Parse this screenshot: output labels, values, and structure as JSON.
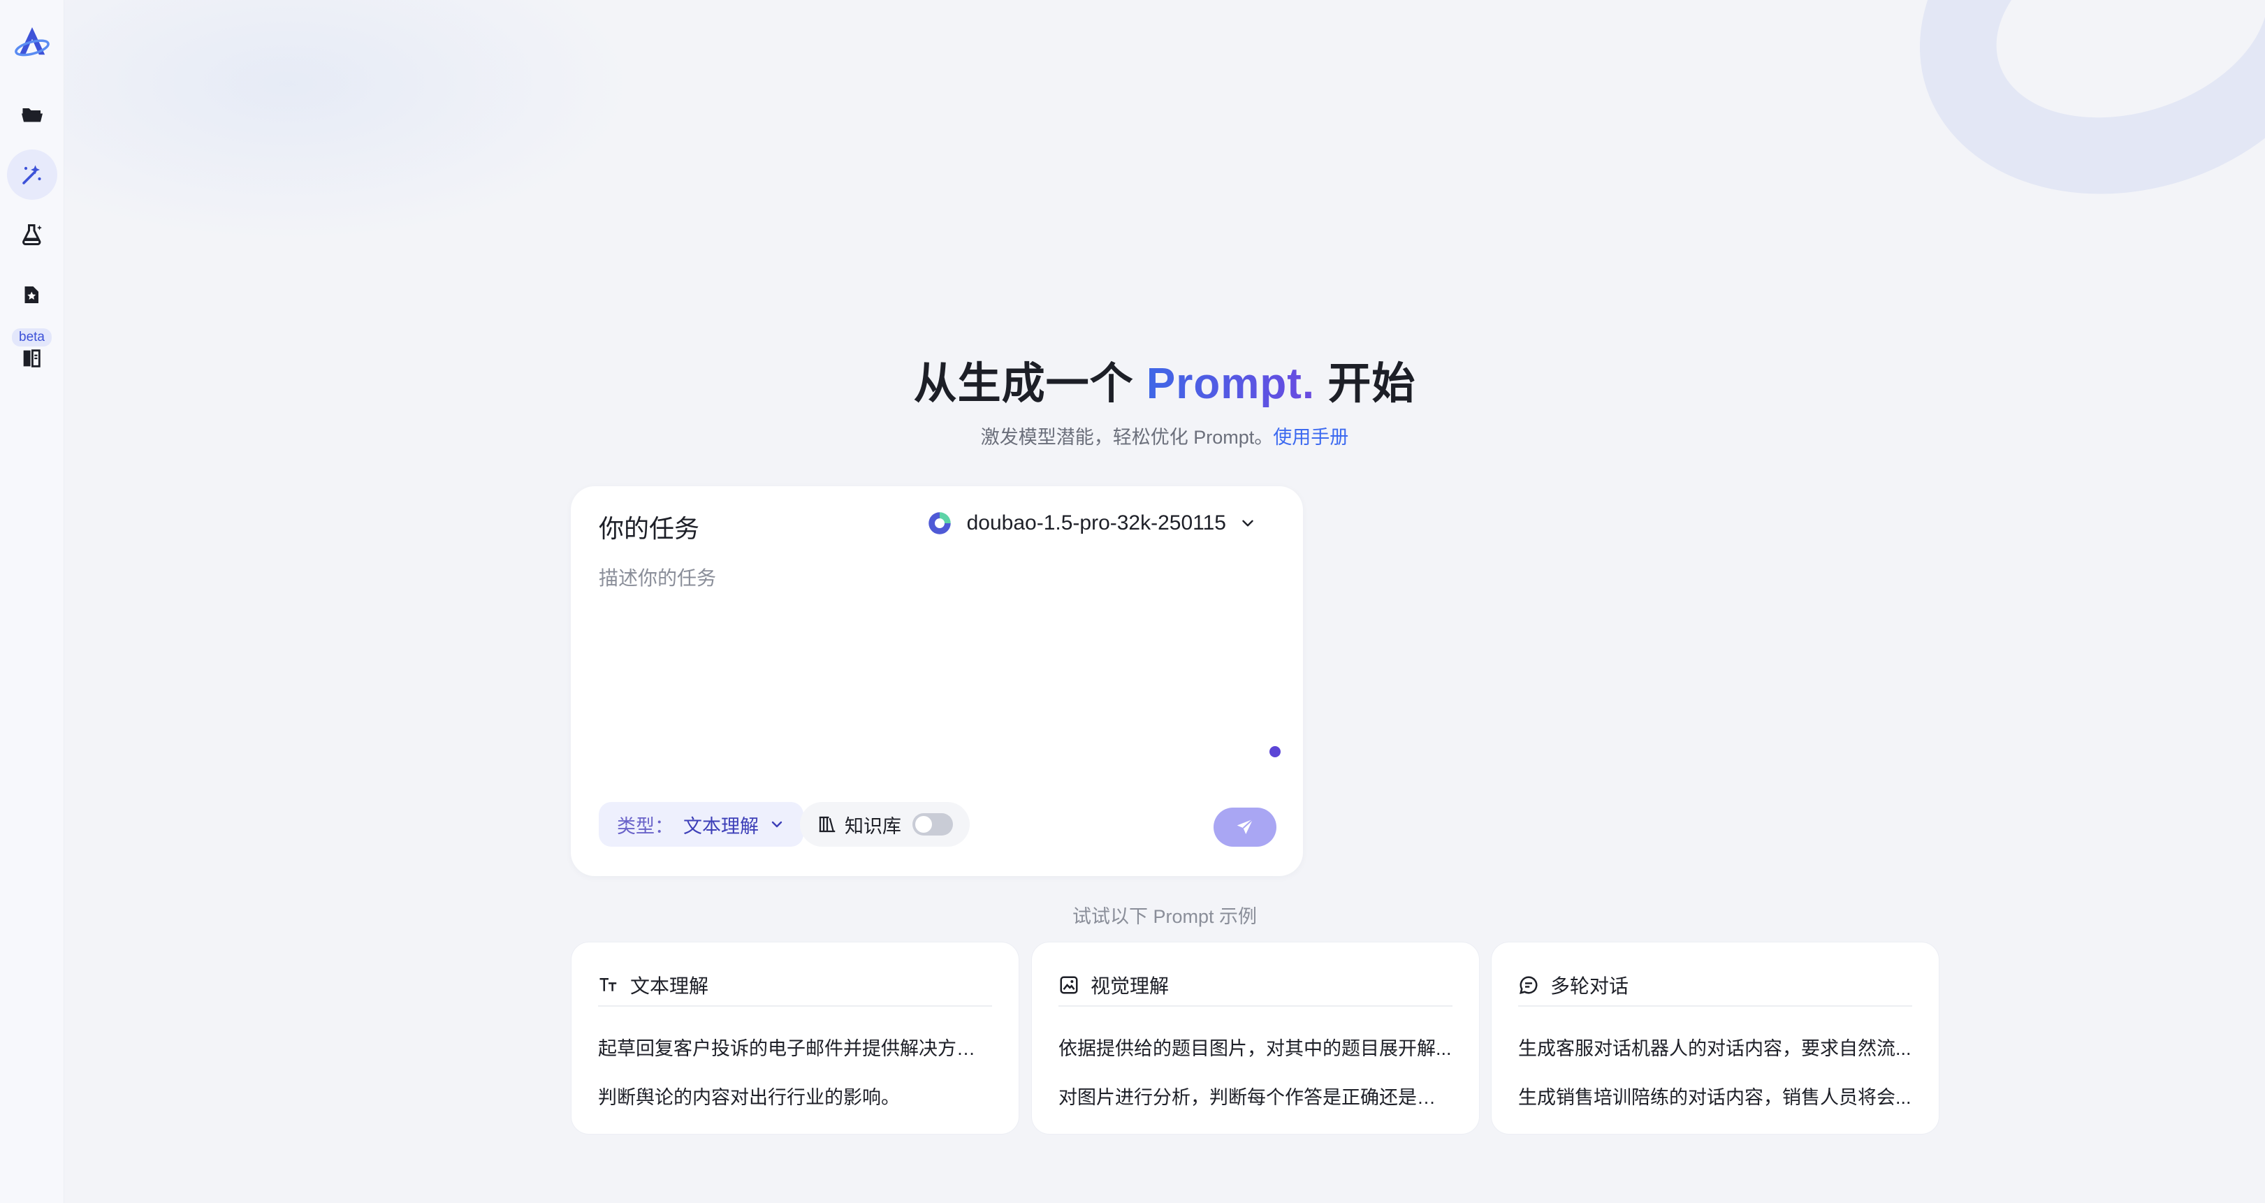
{
  "sidebar": {
    "items": [
      {
        "name": "folder-icon"
      },
      {
        "name": "magic-wand-icon",
        "active": true
      },
      {
        "name": "flask-icon"
      },
      {
        "name": "puzzle-icon"
      },
      {
        "name": "book-icon",
        "badge": "beta"
      }
    ],
    "beta_label": "beta"
  },
  "hero": {
    "title_prefix": "从生成一个 ",
    "title_accent": "Prompt.",
    "title_suffix": " 开始",
    "subtitle": "激发模型潜能，轻松优化 Prompt。",
    "manual_link": "使用手册"
  },
  "task": {
    "title": "你的任务",
    "model": "doubao-1.5-pro-32k-250115",
    "placeholder": "描述你的任务",
    "type_label": "类型：",
    "type_value": "文本理解",
    "knowledge_label": "知识库"
  },
  "examples": {
    "hint": "试试以下 Prompt 示例",
    "cards": [
      {
        "icon": "text-type-icon",
        "title": "文本理解",
        "items": [
          "起草回复客户投诉的电子邮件并提供解决方案。",
          "判断舆论的内容对出行行业的影响。"
        ]
      },
      {
        "icon": "image-icon",
        "title": "视觉理解",
        "items": [
          "依据提供给的题目图片，对其中的题目展开解...",
          "对图片进行分析，判断每个作答是正确还是错误"
        ]
      },
      {
        "icon": "chat-bubble-icon",
        "title": "多轮对话",
        "items": [
          "生成客服对话机器人的对话内容，要求自然流...",
          "生成销售培训陪练的对话内容，销售人员将会..."
        ]
      }
    ]
  },
  "colors": {
    "accent": "#3f67e6",
    "send_button": "#a9a6f3",
    "sidebar_active": "#e7eafb"
  }
}
